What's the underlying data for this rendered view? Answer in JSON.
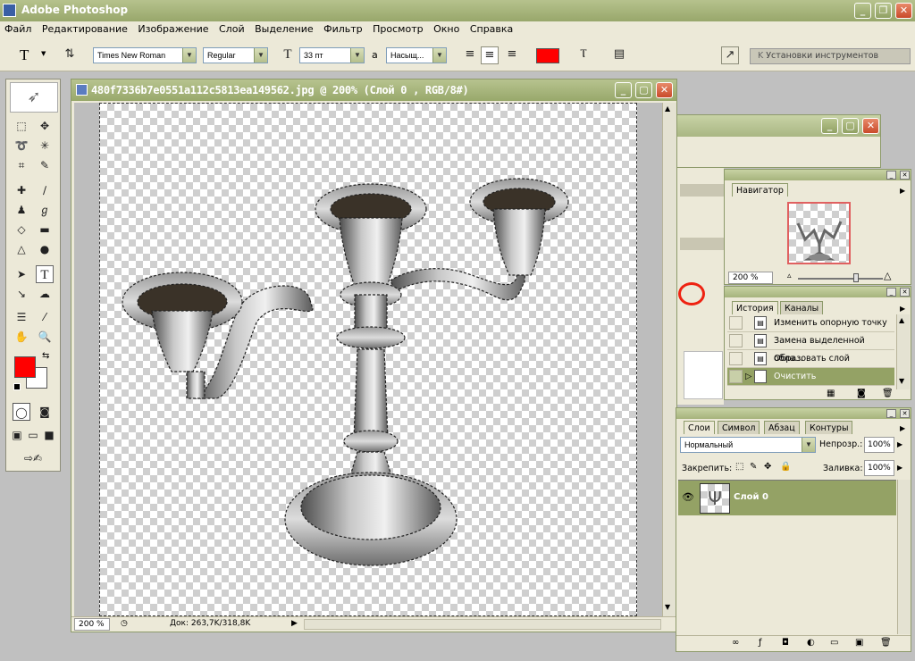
{
  "app": {
    "title": "Adobe Photoshop"
  },
  "menu": [
    "Файл",
    "Редактирование",
    "Изображение",
    "Слой",
    "Выделение",
    "Фильтр",
    "Просмотр",
    "Окно",
    "Справка"
  ],
  "options": {
    "tool_glyph": "T",
    "font_family": "Times New Roman",
    "font_style": "Regular",
    "font_size": "33 пт",
    "aa_label": "a",
    "antialias": "Насыщ...",
    "text_color": "#ff0000",
    "presets_label": "Установки инструментов"
  },
  "document": {
    "title": "480f7336b7e0551a112c5813ea149562.jpg @ 200% (Слой 0 , RGB/8#)",
    "zoom": "200 %",
    "doc_info": "Док: 263,7K/318,8K"
  },
  "colors": {
    "foreground": "#ff0000",
    "background": "#ffffff",
    "accent": "#8a9a5f"
  },
  "navigator": {
    "title": "Навигатор",
    "zoom": "200 %"
  },
  "history": {
    "tabs": [
      "История",
      "Каналы"
    ],
    "items": [
      "Изменить опорную точку",
      "Замена выделенной обла...",
      "Образовать слой",
      "Очистить"
    ]
  },
  "layers": {
    "tabs": [
      "Слои",
      "Символ",
      "Абзац",
      "Контуры"
    ],
    "blend_mode": "Нормальный",
    "opacity_label": "Непрозр.:",
    "opacity": "100%",
    "lock_label": "Закрепить:",
    "fill_label": "Заливка:",
    "fill": "100%",
    "layer_name": "Слой 0"
  }
}
